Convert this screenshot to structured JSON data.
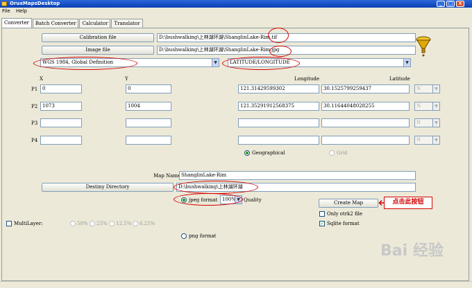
{
  "window": {
    "title": "OruxMapsDesktop",
    "controls": [
      "_",
      "□",
      "×"
    ]
  },
  "menu": [
    "File",
    "Help"
  ],
  "tabs": [
    "Converter",
    "Batch Converter",
    "Calculator",
    "Translator"
  ],
  "calibration": {
    "button": "Calibration file",
    "path": "D:\\bushwalking\\上林湖环湖\\ShanglinLake-Rim.tif"
  },
  "image": {
    "button": "Image file",
    "path": "D:\\bushwalking\\上林湖环湖\\ShanglinLake-Rim.jpg"
  },
  "datum": "WGS 1984, Global Definition",
  "projection": "LATITUDE/LONGITUDE",
  "columns": {
    "x": "X",
    "y": "Y",
    "longitude": "Longitude",
    "latitude": "Latitude"
  },
  "points": [
    {
      "label": "P1",
      "x": "0",
      "y": "0",
      "longitude": "121.31429599302",
      "latitude": "30.1525799259437",
      "hemi": "N"
    },
    {
      "label": "P2",
      "x": "1073",
      "y": "1004",
      "longitude": "121.35291912568375",
      "latitude": "30.11644048028255",
      "hemi": "N"
    },
    {
      "label": "P3",
      "x": "",
      "y": "",
      "longitude": "",
      "latitude": "",
      "hemi": "N"
    },
    {
      "label": "P4",
      "x": "",
      "y": "",
      "longitude": "",
      "latitude": "",
      "hemi": "N"
    }
  ],
  "coord_mode": {
    "geographical": "Geographical",
    "grid": "Grid"
  },
  "map_name": {
    "label": "Map Name",
    "value": "ShanglinLake-Rim"
  },
  "destiny": {
    "button": "Destiny Directory",
    "path": "D:\\bushwalking\\上林湖环湖"
  },
  "format": {
    "jpeg": "jpeg format",
    "quality_value": "100%",
    "quality_label": "Quality",
    "png": "png format"
  },
  "create": {
    "button": "Create Map",
    "callout": "点击此按钮"
  },
  "options": {
    "only_otrk2": "Only otrk2 file",
    "sqlite": "Sqlite format"
  },
  "multilayer": {
    "label": "MultiLayer:",
    "levels": [
      "50%",
      "25%",
      "12.5%",
      "6.25%"
    ]
  },
  "watermark": "Bai 经验",
  "colors": {
    "annotation": "#d40000",
    "title_bar": "#0a3fb3"
  }
}
